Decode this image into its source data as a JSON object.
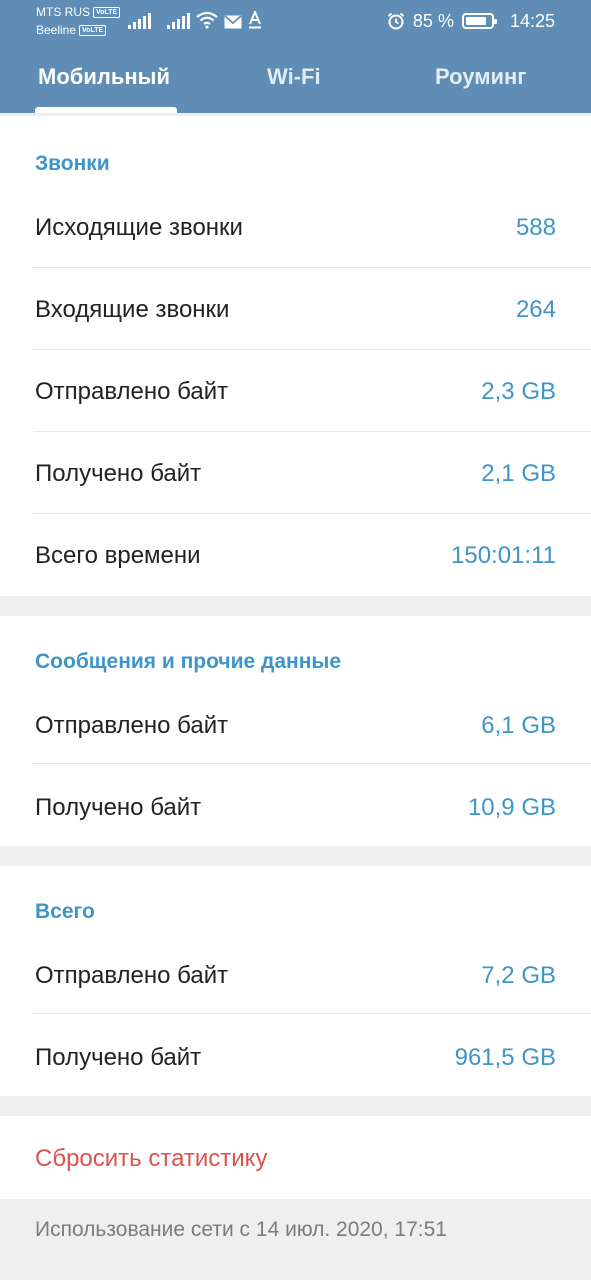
{
  "status_bar": {
    "carrier1": "MTS RUS",
    "carrier2": "Beeline",
    "volte_badge": "VoLTE",
    "battery_percent": "85 %",
    "battery_level": 0.85,
    "time": "14:25",
    "icons": [
      "signal-icon",
      "signal-icon",
      "wifi-icon",
      "mail-icon",
      "font-a-icon",
      "alarm-icon",
      "battery-icon"
    ]
  },
  "tabs": [
    {
      "label": "Мобильный",
      "active": true
    },
    {
      "label": "Wi-Fi",
      "active": false
    },
    {
      "label": "Роуминг",
      "active": false
    }
  ],
  "sections": {
    "calls": {
      "title": "Звонки",
      "rows": [
        {
          "label": "Исходящие звонки",
          "value": "588"
        },
        {
          "label": "Входящие звонки",
          "value": "264"
        },
        {
          "label": "Отправлено байт",
          "value": "2,3 GB"
        },
        {
          "label": "Получено байт",
          "value": "2,1 GB"
        },
        {
          "label": "Всего времени",
          "value": "150:01:11"
        }
      ]
    },
    "messages": {
      "title": "Сообщения и прочие данные",
      "rows": [
        {
          "label": "Отправлено байт",
          "value": "6,1 GB"
        },
        {
          "label": "Получено байт",
          "value": "10,9 GB"
        }
      ]
    },
    "total": {
      "title": "Всего",
      "rows": [
        {
          "label": "Отправлено байт",
          "value": "7,2 GB"
        },
        {
          "label": "Получено байт",
          "value": "961,5 GB"
        }
      ]
    }
  },
  "reset_label": "Сбросить статистику",
  "footer_text": "Использование сети с 14 июл. 2020, 17:51",
  "colors": {
    "header": "#5f8db5",
    "accent": "#3e95c9",
    "danger": "#d9534f"
  }
}
